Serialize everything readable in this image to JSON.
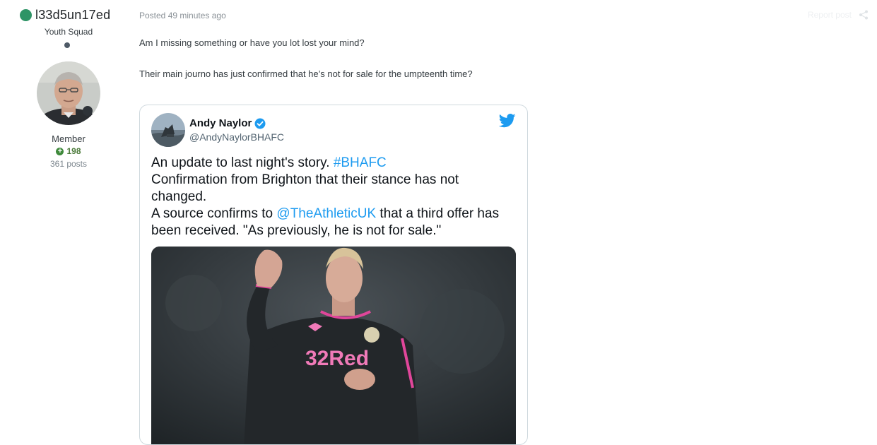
{
  "author": {
    "username": "l33d5un17ed",
    "title": "Youth Squad",
    "group": "Member",
    "reputation": "198",
    "post_count": "361 posts",
    "online_color": "#2e9466"
  },
  "post": {
    "posted": "Posted 49 minutes ago",
    "report_label": "Report post",
    "paragraphs": [
      "Am I missing something or have you lot lost your mind?",
      "Their main journo has just confirmed that he’s not for sale for the umpteenth time?"
    ]
  },
  "tweet": {
    "name": "Andy Naylor",
    "handle": "@AndyNaylorBHAFC",
    "line1_text": "An update to last night's story. ",
    "line1_hashtag": "#BHAFC",
    "line2": "Confirmation from Brighton that their stance has not",
    "line3": "changed.",
    "line4_pre": "A source confirms to ",
    "line4_mention": "@TheAthleticUK",
    "line4_post": " that a third offer has",
    "line5": "been received. \"As previously, he is not for sale.\"",
    "shirt_sponsor": "32Red",
    "accent_color": "#1d9bf0"
  }
}
